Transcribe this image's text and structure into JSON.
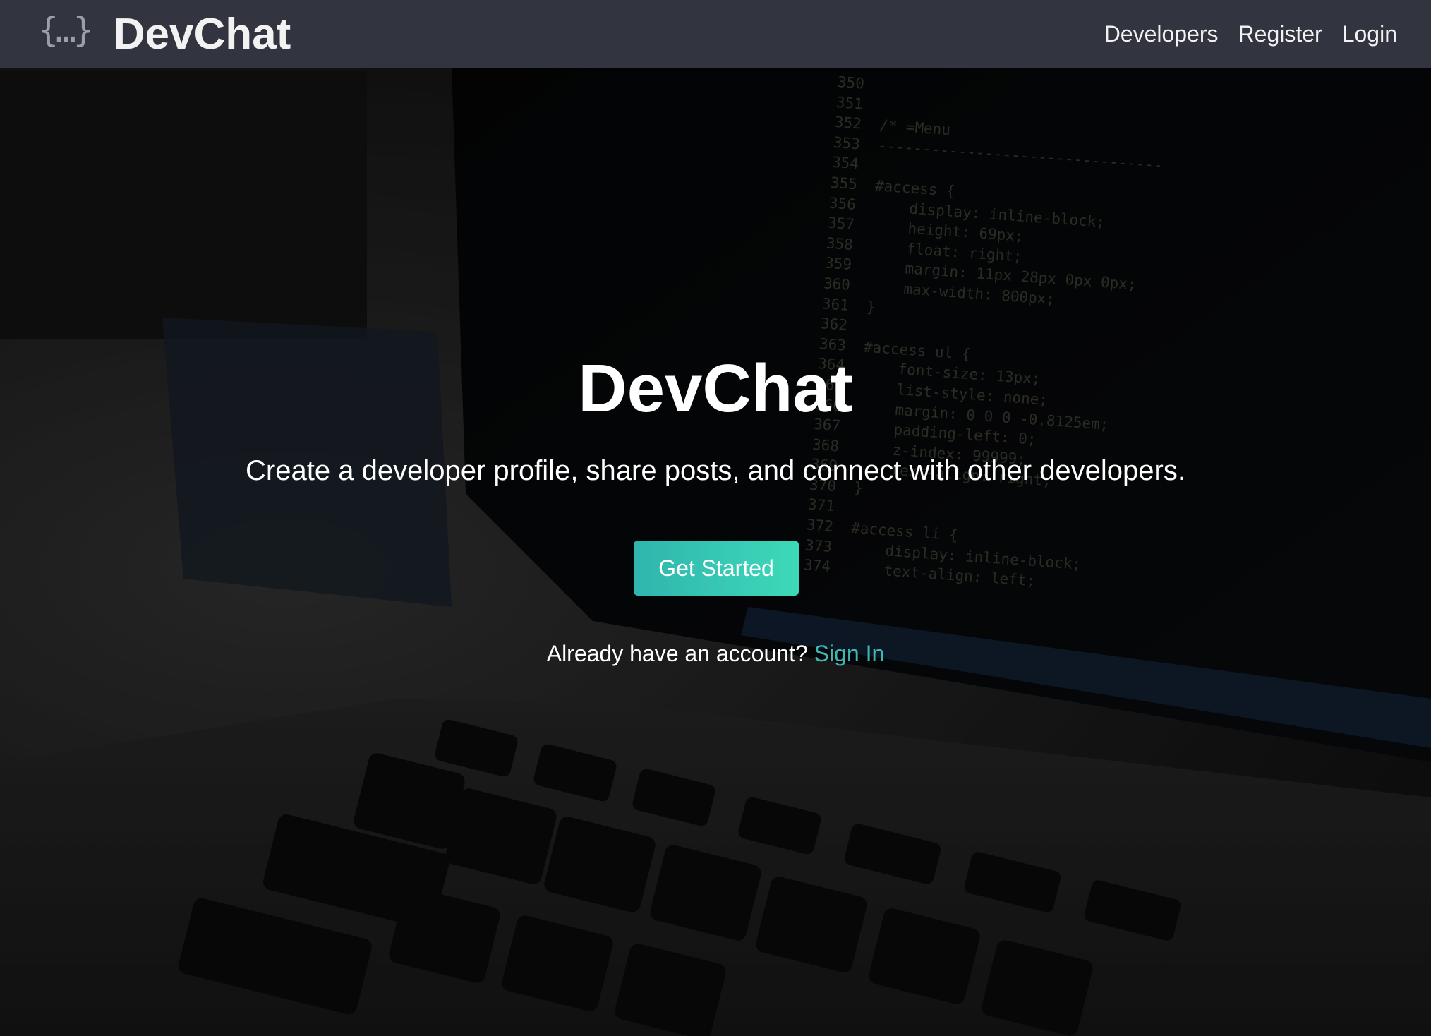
{
  "navbar": {
    "brand_icon": "{…}",
    "brand_name": "DevChat",
    "links": [
      {
        "label": "Developers"
      },
      {
        "label": "Register"
      },
      {
        "label": "Login"
      }
    ]
  },
  "landing": {
    "title": "DevChat",
    "lead": "Create a developer profile, share posts, and connect with other developers.",
    "cta_label": "Get Started",
    "signin_prompt": "Already have an account?",
    "signin_link": "Sign In"
  },
  "background": {
    "code_lines": [
      "350",
      "351",
      "352  /* =Menu",
      "353  --------------------------------",
      "354",
      "355  #access {",
      "356      display: inline-block;",
      "357      height: 69px;",
      "358      float: right;",
      "359      margin: 11px 28px 0px 0px;",
      "360      max-width: 800px;",
      "361  }",
      "362",
      "363  #access ul {",
      "364      font-size: 13px;",
      "365      list-style: none;",
      "366      margin: 0 0 0 -0.8125em;",
      "367      padding-left: 0;",
      "368      z-index: 99999;",
      "369      text-align: right;",
      "370  }",
      "371",
      "372  #access li {",
      "373      display: inline-block;",
      "374      text-align: left;"
    ]
  },
  "colors": {
    "navbar_bg": "#343742",
    "accent": "#3fb8b5",
    "button_start": "#2fb5ad",
    "button_end": "#3dd9b9"
  }
}
